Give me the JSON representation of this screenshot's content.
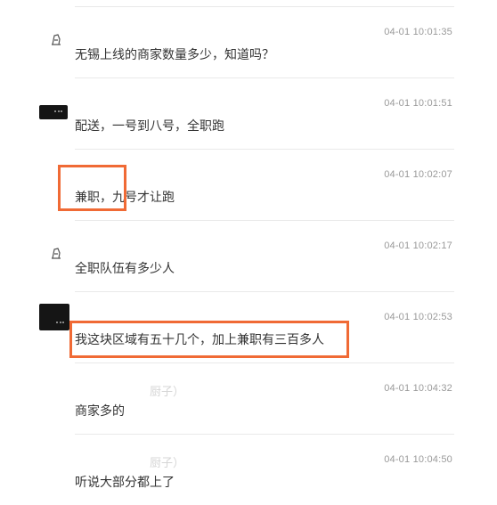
{
  "messages": [
    {
      "time": "04-01 10:01:35",
      "text": "无锡上线的商家数量多少，知道吗？",
      "sender": "",
      "avatar": "sketch-avatar-icon"
    },
    {
      "time": "04-01 10:01:51",
      "text": "配送，一号到八号，全职跑",
      "sender": "",
      "avatar": "dark-avatar-icon"
    },
    {
      "time": "04-01 10:02:07",
      "text": "兼职，九号才让跑",
      "sender": "",
      "avatar": ""
    },
    {
      "time": "04-01 10:02:17",
      "text": "全职队伍有多少人",
      "sender": "",
      "avatar": "sketch-avatar-icon"
    },
    {
      "time": "04-01 10:02:53",
      "text": "我这块区域有五十几个，加上兼职有三百多人",
      "sender": "",
      "avatar": "dark-avatar-icon"
    },
    {
      "time": "04-01 10:04:32",
      "text": "商家多的",
      "sender": "厨子）",
      "avatar": ""
    },
    {
      "time": "04-01 10:04:50",
      "text": "听说大部分都上了",
      "sender": "厨子）",
      "avatar": ""
    }
  ],
  "highlight_color": "#f06a35"
}
